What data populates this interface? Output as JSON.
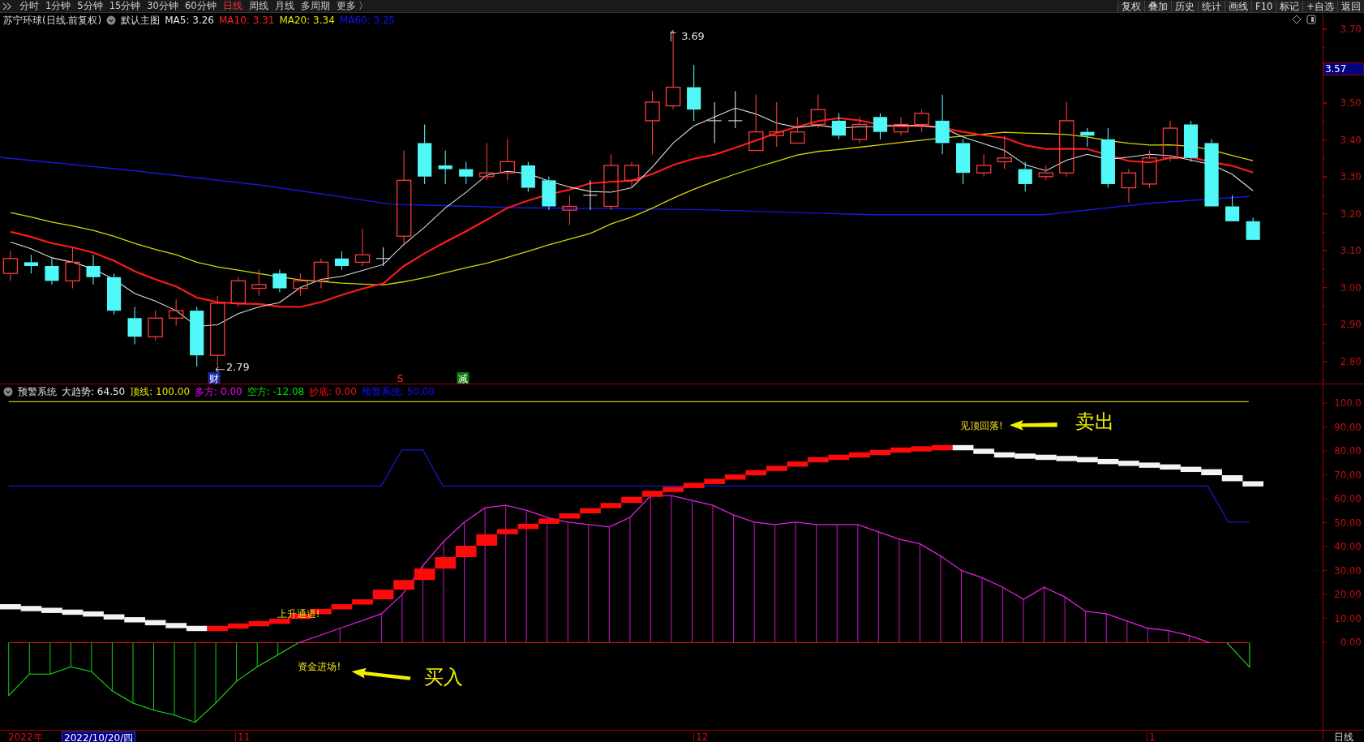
{
  "toolbar": {
    "periods": [
      {
        "label": "分时",
        "selected": false
      },
      {
        "label": "1分钟",
        "selected": false
      },
      {
        "label": "5分钟",
        "selected": false
      },
      {
        "label": "15分钟",
        "selected": false
      },
      {
        "label": "30分钟",
        "selected": false
      },
      {
        "label": "60分钟",
        "selected": false
      },
      {
        "label": "日线",
        "selected": true
      },
      {
        "label": "周线",
        "selected": false
      },
      {
        "label": "月线",
        "selected": false
      },
      {
        "label": "多周期",
        "selected": false
      },
      {
        "label": "更多 〉",
        "selected": false
      }
    ],
    "actions": [
      "复权",
      "叠加",
      "历史",
      "统计",
      "画线",
      "F10",
      "标记",
      "+自选",
      "返回"
    ]
  },
  "main_chart": {
    "legend": {
      "title": "苏宁环球(日线.前复权)",
      "template": "默认主图",
      "indicators": [
        {
          "label": "MA5: 3.26",
          "color": "#e8e8e8"
        },
        {
          "label": "MA10: 3.31",
          "color": "#ff2020"
        },
        {
          "label": "MA20: 3.34",
          "color": "#e6e600"
        },
        {
          "label": "MA60: 3.25",
          "color": "#1010ff"
        }
      ]
    },
    "high_label": "3.69",
    "low_label": "2.79",
    "markers": [
      {
        "text": "财",
        "kind": "finance"
      },
      {
        "text": "S",
        "kind": "sell"
      },
      {
        "text": "减",
        "kind": "reduce"
      }
    ]
  },
  "price_axis": {
    "labels": [
      "3.70",
      "3.50",
      "3.40",
      "3.30",
      "3.20",
      "3.10",
      "3.00",
      "2.90",
      "2.80"
    ],
    "current_price": "3.57"
  },
  "indicator_panel": {
    "legend": {
      "title": "预警系统",
      "indicators": [
        {
          "label": "大趋势: 64.50",
          "color": "#e8e8e8"
        },
        {
          "label": "顶线: 100.00",
          "color": "#e6e600"
        },
        {
          "label": "多方: 0.00",
          "color": "#ff00ff"
        },
        {
          "label": "空方: -12.08",
          "color": "#00e000"
        },
        {
          "label": "抄底: 0.00",
          "color": "#ff1010"
        },
        {
          "label": "预警系统: 50.00",
          "color": "#1010ff"
        }
      ]
    },
    "annotations": [
      {
        "text": "见顶回落!",
        "kind": "note"
      },
      {
        "text": "卖出",
        "kind": "signal"
      },
      {
        "text": "上升通道!",
        "kind": "note"
      },
      {
        "text": "资金进场!",
        "kind": "note"
      },
      {
        "text": "买入",
        "kind": "signal"
      }
    ]
  },
  "indicator_axis": {
    "labels": [
      "100.0",
      "90.00",
      "80.00",
      "70.00",
      "60.00",
      "50.00",
      "40.00",
      "30.00",
      "20.00",
      "10.00",
      "0.00"
    ]
  },
  "time_axis": {
    "year": "2022年",
    "cursor_date": "2022/10/20/四",
    "months": [
      "11",
      "12",
      "1"
    ]
  },
  "period_label": "日线"
}
